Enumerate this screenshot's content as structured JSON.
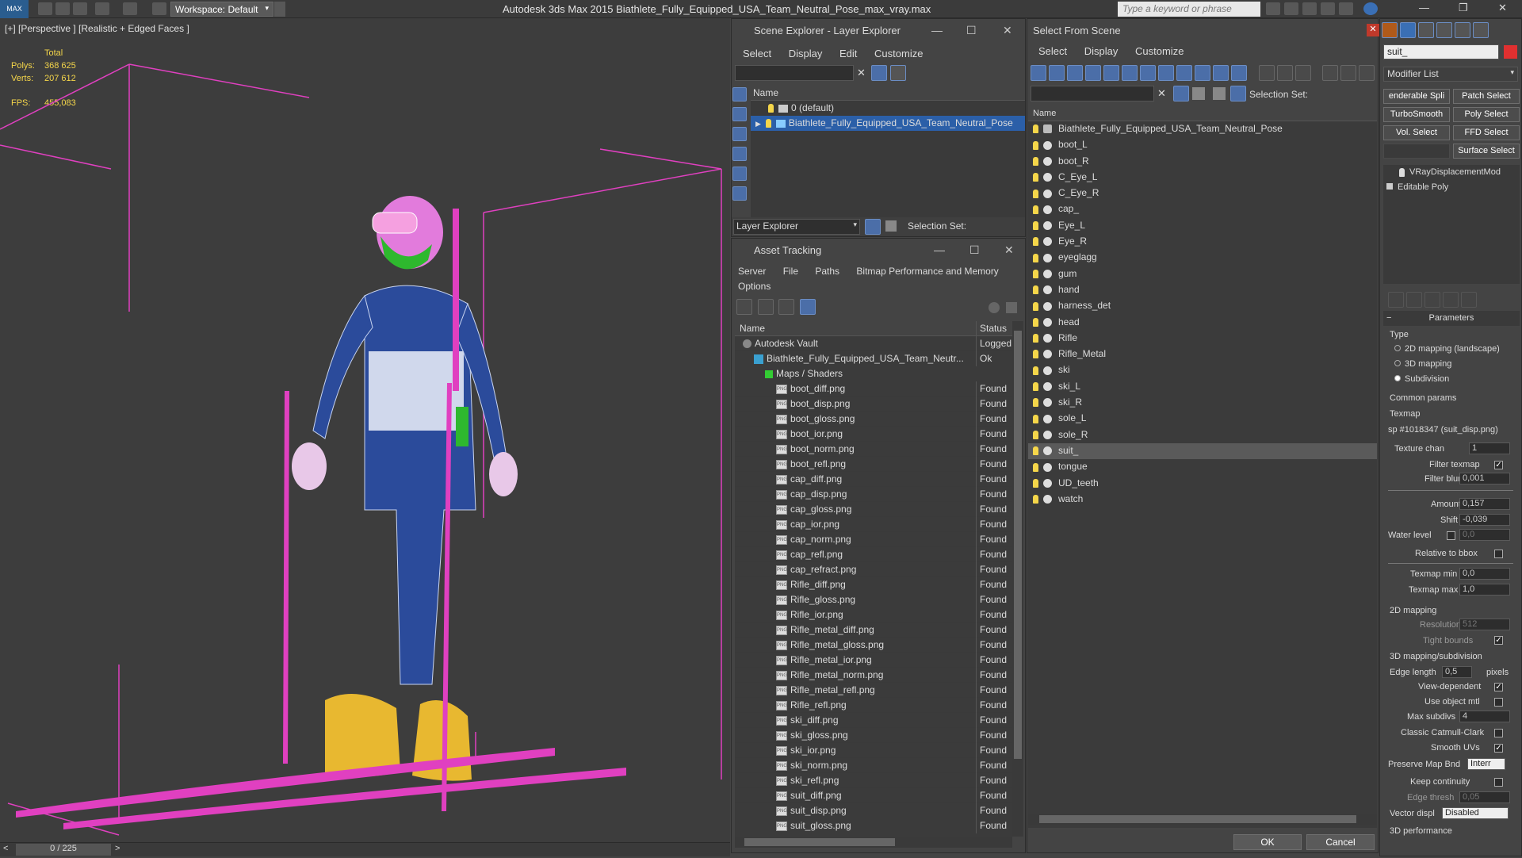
{
  "titlebar": {
    "workspace": "Workspace: Default",
    "app_title": "Autodesk 3ds Max  2015    Biathlete_Fully_Equipped_USA_Team_Neutral_Pose_max_vray.max",
    "search_placeholder": "Type a keyword or phrase"
  },
  "viewport": {
    "label": "[+] [Perspective ] [Realistic + Edged Faces ]",
    "stats": {
      "total": "Total",
      "polys_label": "Polys:",
      "polys": "368 625",
      "verts_label": "Verts:",
      "verts": "207 612",
      "fps_label": "FPS:",
      "fps": "455,083"
    },
    "frame": "0 / 225"
  },
  "layer_explorer": {
    "title": "Scene Explorer - Layer Explorer",
    "menu": [
      "Select",
      "Display",
      "Edit",
      "Customize"
    ],
    "col_name": "Name",
    "rows": [
      "0 (default)",
      "Biathlete_Fully_Equipped_USA_Team_Neutral_Pose"
    ],
    "footer_label": "Layer Explorer",
    "selection_set": "Selection Set:"
  },
  "asset_tracking": {
    "title": "Asset Tracking",
    "menu": [
      "Server",
      "File",
      "Paths",
      "Bitmap Performance and Memory"
    ],
    "menu2": "Options",
    "col_name": "Name",
    "col_status": "Status",
    "rows": [
      {
        "name": "Autodesk Vault",
        "status": "Logged",
        "indent": 0
      },
      {
        "name": "Biathlete_Fully_Equipped_USA_Team_Neutr...",
        "status": "Ok",
        "indent": 1
      },
      {
        "name": "Maps / Shaders",
        "status": "",
        "indent": 2
      },
      {
        "name": "boot_diff.png",
        "status": "Found",
        "indent": 3
      },
      {
        "name": "boot_disp.png",
        "status": "Found",
        "indent": 3
      },
      {
        "name": "boot_gloss.png",
        "status": "Found",
        "indent": 3
      },
      {
        "name": "boot_ior.png",
        "status": "Found",
        "indent": 3
      },
      {
        "name": "boot_norm.png",
        "status": "Found",
        "indent": 3
      },
      {
        "name": "boot_refl.png",
        "status": "Found",
        "indent": 3
      },
      {
        "name": "cap_diff.png",
        "status": "Found",
        "indent": 3
      },
      {
        "name": "cap_disp.png",
        "status": "Found",
        "indent": 3
      },
      {
        "name": "cap_gloss.png",
        "status": "Found",
        "indent": 3
      },
      {
        "name": "cap_ior.png",
        "status": "Found",
        "indent": 3
      },
      {
        "name": "cap_norm.png",
        "status": "Found",
        "indent": 3
      },
      {
        "name": "cap_refl.png",
        "status": "Found",
        "indent": 3
      },
      {
        "name": "cap_refract.png",
        "status": "Found",
        "indent": 3
      },
      {
        "name": "Rifle_diff.png",
        "status": "Found",
        "indent": 3
      },
      {
        "name": "Rifle_gloss.png",
        "status": "Found",
        "indent": 3
      },
      {
        "name": "Rifle_ior.png",
        "status": "Found",
        "indent": 3
      },
      {
        "name": "Rifle_metal_diff.png",
        "status": "Found",
        "indent": 3
      },
      {
        "name": "Rifle_metal_gloss.png",
        "status": "Found",
        "indent": 3
      },
      {
        "name": "Rifle_metal_ior.png",
        "status": "Found",
        "indent": 3
      },
      {
        "name": "Rifle_metal_norm.png",
        "status": "Found",
        "indent": 3
      },
      {
        "name": "Rifle_metal_refl.png",
        "status": "Found",
        "indent": 3
      },
      {
        "name": "Rifle_refl.png",
        "status": "Found",
        "indent": 3
      },
      {
        "name": "ski_diff.png",
        "status": "Found",
        "indent": 3
      },
      {
        "name": "ski_gloss.png",
        "status": "Found",
        "indent": 3
      },
      {
        "name": "ski_ior.png",
        "status": "Found",
        "indent": 3
      },
      {
        "name": "ski_norm.png",
        "status": "Found",
        "indent": 3
      },
      {
        "name": "ski_refl.png",
        "status": "Found",
        "indent": 3
      },
      {
        "name": "suit_diff.png",
        "status": "Found",
        "indent": 3
      },
      {
        "name": "suit_disp.png",
        "status": "Found",
        "indent": 3
      },
      {
        "name": "suit_gloss.png",
        "status": "Found",
        "indent": 3
      }
    ]
  },
  "select_from_scene": {
    "title": "Select From Scene",
    "menu": [
      "Select",
      "Display",
      "Customize"
    ],
    "selection_set": "Selection Set:",
    "col_name": "Name",
    "rows": [
      "Biathlete_Fully_Equipped_USA_Team_Neutral_Pose",
      "boot_L",
      "boot_R",
      "C_Eye_L",
      "C_Eye_R",
      "cap_",
      "Eye_L",
      "Eye_R",
      "eyeglagg",
      "gum",
      "hand",
      "harness_det",
      "head",
      "Rifle",
      "Rifle_Metal",
      "ski",
      "ski_L",
      "ski_R",
      "sole_L",
      "sole_R",
      "suit_",
      "tongue",
      "UD_teeth",
      "watch"
    ],
    "selected": "suit_",
    "ok": "OK",
    "cancel": "Cancel"
  },
  "command_panel": {
    "object_name": "suit_",
    "modifier_list": "Modifier List",
    "buttons": [
      "enderable Spli",
      "Patch Select",
      "TurboSmooth",
      "Poly Select",
      "Vol. Select",
      "FFD Select",
      "",
      "Surface Select"
    ],
    "stack": [
      "VRayDisplacementMod",
      "Editable Poly"
    ],
    "parameters": "Parameters",
    "type_label": "Type",
    "type_opts": [
      "2D mapping (landscape)",
      "3D mapping",
      "Subdivision"
    ],
    "common_params": "Common params",
    "texmap_label": "Texmap",
    "texmap_value": "sp #1018347 (suit_disp.png)",
    "texture_chan_label": "Texture chan",
    "texture_chan": "1",
    "filter_texmap": "Filter texmap",
    "filter_blur_label": "Filter blur",
    "filter_blur": "0,001",
    "amount_label": "Amount",
    "amount": "0,157",
    "shift_label": "Shift",
    "shift": "-0,039",
    "water_level_label": "Water level",
    "water_level": "0,0",
    "relative_bbox": "Relative to bbox",
    "texmap_min_label": "Texmap min",
    "texmap_min": "0,0",
    "texmap_max_label": "Texmap max",
    "texmap_max": "1,0",
    "mapping2d": "2D mapping",
    "resolution_label": "Resolution",
    "resolution": "512",
    "tight_bounds": "Tight bounds",
    "mapping3d": "3D mapping/subdivision",
    "edge_length_label": "Edge length",
    "edge_length": "0,5",
    "pixels": "pixels",
    "view_dependent": "View-dependent",
    "use_object_mtl": "Use object mtl",
    "max_subdivs_label": "Max subdivs",
    "max_subdivs": "4",
    "classic_cc": "Classic Catmull-Clark",
    "smooth_uvs": "Smooth UVs",
    "preserve_map_label": "Preserve Map Bnd",
    "preserve_map": "Interr",
    "keep_continuity": "Keep continuity",
    "edge_thresh_label": "Edge thresh",
    "edge_thresh": "0,05",
    "vector_displ_label": "Vector displ",
    "vector_displ": "Disabled",
    "perf_3d": "3D performance"
  }
}
